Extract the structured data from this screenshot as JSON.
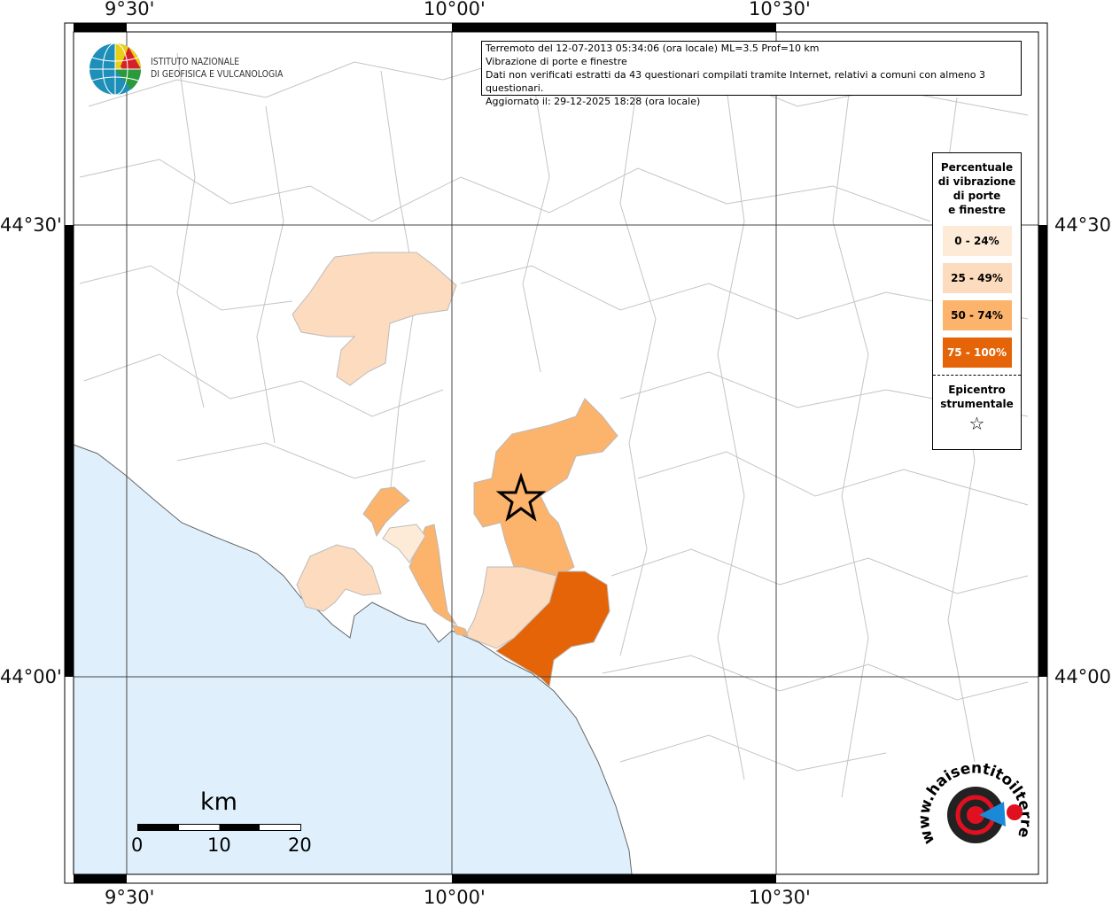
{
  "logo": {
    "name": "Istituto Nazionale di Geofisica e Vulcanologia",
    "line1": "ISTITUTO NAZIONALE",
    "line2": "DI GEOFISICA E VULCANOLOGIA"
  },
  "info": {
    "line1": "Terremoto del 12-07-2013 05:34:06 (ora locale) ML=3.5 Prof=10 km",
    "line2": "Vibrazione di porte e finestre",
    "line3": "Dati non verificati estratti da 43 questionari compilati tramite Internet, relativi a comuni con almeno 3 questionari.",
    "line4": "Aggiornato il: 29-12-2025 18:28 (ora locale)"
  },
  "axes": {
    "lon_top": [
      "9°30'",
      "10°00'",
      "10°30'"
    ],
    "lon_bottom": [
      "9°30'",
      "10°00'",
      "10°30'"
    ],
    "lat_left": [
      "44°30'",
      "44°00'"
    ],
    "lat_right": [
      "44°30'",
      "44°00'"
    ]
  },
  "legend": {
    "title": [
      "Percentuale",
      "di vibrazione",
      "di porte",
      "e finestre"
    ],
    "classes": [
      {
        "label": "0 - 24%",
        "color": "#fdebd7"
      },
      {
        "label": "25 - 49%",
        "color": "#fddbbe"
      },
      {
        "label": "50 - 74%",
        "color": "#fcb36c"
      },
      {
        "label": "75 - 100%",
        "color": "#e56407"
      }
    ],
    "epicenter": [
      "Epicentro",
      "strumentale"
    ],
    "epicenter_icon": "star-icon"
  },
  "scale": {
    "unit": "km",
    "labels": [
      "0",
      "10",
      "20"
    ]
  },
  "colors": {
    "sea": "#dff0fc",
    "border": "#b3b3b3"
  },
  "watermark": {
    "text": "www.haisentitoilterremoto.it"
  }
}
